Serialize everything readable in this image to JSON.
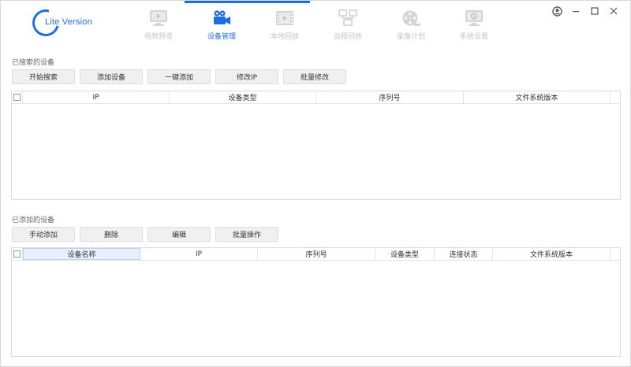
{
  "logo": {
    "text": "Lite Version"
  },
  "nav": {
    "tabs": [
      {
        "label": "视频预览",
        "icon": "monitor-play-icon",
        "active": false
      },
      {
        "label": "设备管理",
        "icon": "video-camera-icon",
        "active": true
      },
      {
        "label": "本地回放",
        "icon": "film-icon",
        "active": false
      },
      {
        "label": "远程回放",
        "icon": "network-monitors-icon",
        "active": false
      },
      {
        "label": "录像计划",
        "icon": "film-reel-icon",
        "active": false
      },
      {
        "label": "系统设置",
        "icon": "settings-monitor-icon",
        "active": false
      }
    ]
  },
  "colors": {
    "accent": "#1e6fd9",
    "inactive": "#c4c4c4"
  },
  "searched": {
    "title": "已搜索的设备",
    "buttons": [
      "开始搜索",
      "添加设备",
      "一键添加",
      "修改IP",
      "批量修改"
    ],
    "columns": [
      "IP",
      "设备类型",
      "序列号",
      "文件系统版本"
    ]
  },
  "added": {
    "title": "已添加的设备",
    "buttons": [
      "手动添加",
      "删除",
      "编辑",
      "批量操作"
    ],
    "columns": [
      "设备名称",
      "IP",
      "序列号",
      "设备类型",
      "连接状态",
      "文件系统版本"
    ]
  }
}
